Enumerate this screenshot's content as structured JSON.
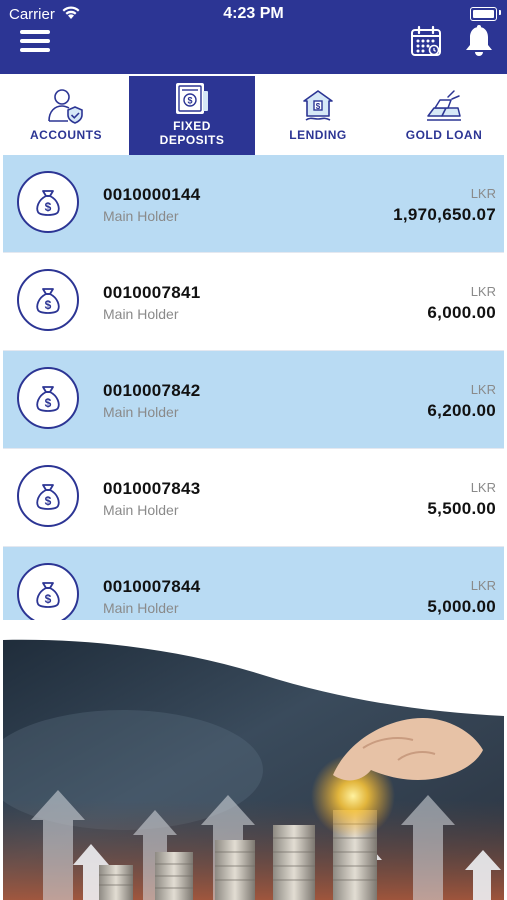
{
  "status_bar": {
    "carrier": "Carrier",
    "time": "4:23 PM"
  },
  "header": {
    "menu_icon": "hamburger-menu-icon",
    "calendar_icon": "calendar-icon",
    "bell_icon": "notification-bell-icon"
  },
  "tabs": [
    {
      "label": "ACCOUNTS",
      "icon": "user-shield-icon",
      "active": false
    },
    {
      "label": "FIXED\nDEPOSITS",
      "label_line1": "FIXED",
      "label_line2": "DEPOSITS",
      "icon": "deposit-document-icon",
      "active": true
    },
    {
      "label": "LENDING",
      "icon": "house-money-icon",
      "active": false
    },
    {
      "label": "GOLD LOAN",
      "icon": "gold-bars-icon",
      "active": false
    }
  ],
  "deposits": [
    {
      "account_no": "0010000144",
      "holder": "Main Holder",
      "currency": "LKR",
      "amount": "1,970,650.07"
    },
    {
      "account_no": "0010007841",
      "holder": "Main Holder",
      "currency": "LKR",
      "amount": "6,000.00"
    },
    {
      "account_no": "0010007842",
      "holder": "Main Holder",
      "currency": "LKR",
      "amount": "6,200.00"
    },
    {
      "account_no": "0010007843",
      "holder": "Main Holder",
      "currency": "LKR",
      "amount": "5,500.00"
    },
    {
      "account_no": "0010007844",
      "holder": "Main Holder",
      "currency": "LKR",
      "amount": "5,000.00"
    }
  ],
  "banner": {
    "image": "coins-growth-banner"
  },
  "colors": {
    "brand": "#2c3594",
    "row_highlight": "#b9dbf3",
    "text_muted": "#8a8a8a"
  }
}
